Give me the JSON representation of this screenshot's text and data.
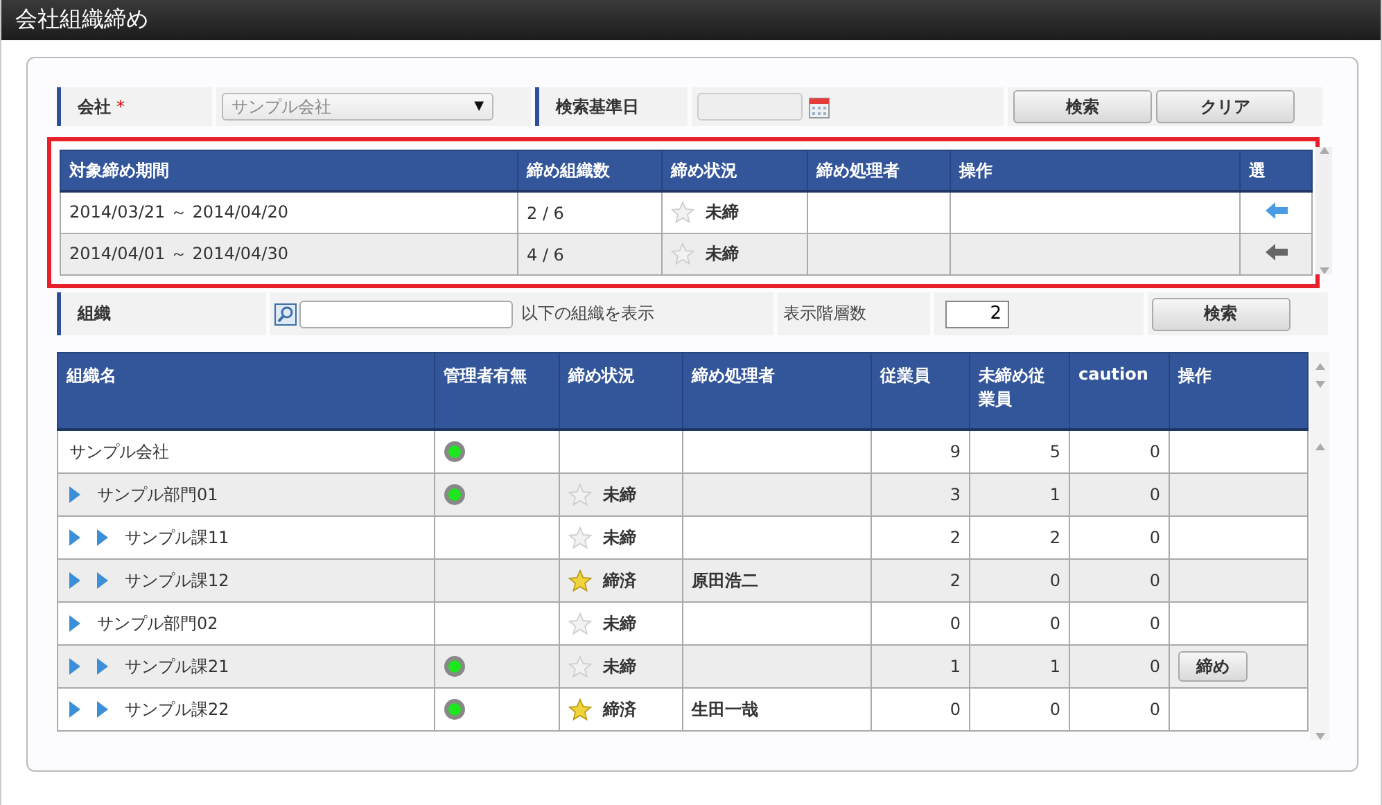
{
  "window": {
    "title": "会社組織締め"
  },
  "search_form": {
    "company_label": "会社",
    "required_mark": "*",
    "company_value": "サンプル会社",
    "dropdown_caret": "▼",
    "date_label": "検索基準日",
    "search_button": "検索",
    "clear_button": "クリア"
  },
  "periods": {
    "highlighted": true,
    "columns": [
      "対象締め期間",
      "締め組織数",
      "締め状況",
      "締め処理者",
      "操作",
      "選"
    ],
    "rows": [
      {
        "period": "2014/03/21 ～ 2014/04/20",
        "count": "2 / 6",
        "closed": false,
        "status": "未締",
        "closer": "",
        "selected": true
      },
      {
        "period": "2014/04/01 ～ 2014/04/30",
        "count": "4 / 6",
        "closed": false,
        "status": "未締",
        "closer": "",
        "selected": false
      }
    ]
  },
  "org_filter": {
    "label": "組織",
    "suffix": "以下の組織を表示",
    "depth_label": "表示階層数",
    "depth_value": "2",
    "search_button": "検索"
  },
  "org_table": {
    "columns": [
      "組織名",
      "管理者有無",
      "締め状況",
      "締め処理者",
      "従業員",
      "未締め従業員",
      "caution",
      "操作"
    ],
    "rows": [
      {
        "name": "サンプル会社",
        "has_manager": true,
        "employees": "9",
        "unclosed": "5",
        "caution": "0",
        "children": [
          {
            "name": "サンプル部門01",
            "has_manager": true,
            "closed": false,
            "status": "未締",
            "employees": "3",
            "unclosed": "1",
            "caution": "0",
            "children": [
              {
                "name": "サンプル課11",
                "has_manager": false,
                "closed": false,
                "status": "未締",
                "employees": "2",
                "unclosed": "2",
                "caution": "0"
              },
              {
                "name": "サンプル課12",
                "has_manager": false,
                "closed": true,
                "status": "締済",
                "closer": "原田浩二",
                "employees": "2",
                "unclosed": "0",
                "caution": "0"
              }
            ]
          },
          {
            "name": "サンプル部門02",
            "has_manager": false,
            "closed": false,
            "status": "未締",
            "employees": "0",
            "unclosed": "0",
            "caution": "0",
            "children": [
              {
                "name": "サンプル課21",
                "has_manager": true,
                "closed": false,
                "status": "未締",
                "employees": "1",
                "unclosed": "1",
                "caution": "0",
                "action": "締め"
              },
              {
                "name": "サンプル課22",
                "has_manager": true,
                "closed": true,
                "status": "締済",
                "closer": "生田一哉",
                "employees": "0",
                "unclosed": "0",
                "caution": "0"
              }
            ]
          }
        ]
      }
    ]
  }
}
